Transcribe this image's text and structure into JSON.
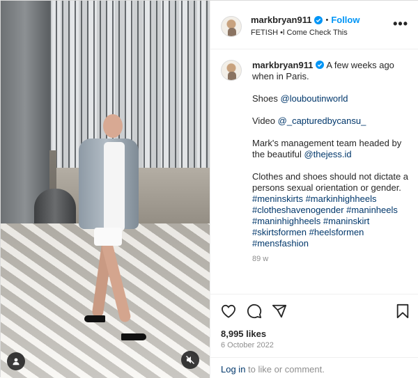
{
  "post": {
    "username": "markbryan911",
    "follow_label": "Follow",
    "separator": "•",
    "audio_line": "FETISH •l Come Check This",
    "more_label": "•••"
  },
  "caption": {
    "username": "markbryan911",
    "intro": "A few weeks ago when in Paris.",
    "shoes_prefix": "Shoes",
    "shoes_handle": "@louboutinworld",
    "video_prefix": "Video",
    "video_handle": "@_capturedbycansu_",
    "management_text": "Mark's management team headed by the beautiful",
    "management_handle": "@thejess.id",
    "statement": "Clothes and shoes should not dictate a persons sexual orientation or gender.",
    "hashtags": "#meninskirts #markinhighheels #clotheshavenogender #maninheels #maninhighheels #maninskirt #skirtsformen #heelsformen #mensfashion",
    "time_ago": "89 w"
  },
  "stats": {
    "likes": "8,995 likes",
    "date": "6 October 2022"
  },
  "login": {
    "link": "Log in",
    "rest": " to like or comment."
  },
  "icons": {
    "like": "heart-icon",
    "comment": "comment-icon",
    "share": "share-icon",
    "save": "bookmark-icon",
    "tags": "person-tag-icon",
    "mute": "speaker-muted-icon",
    "verified": "verified-badge-icon"
  },
  "colors": {
    "accent": "#0095f6",
    "link": "#00376b",
    "muted": "#8e8e8e",
    "text": "#262626"
  }
}
